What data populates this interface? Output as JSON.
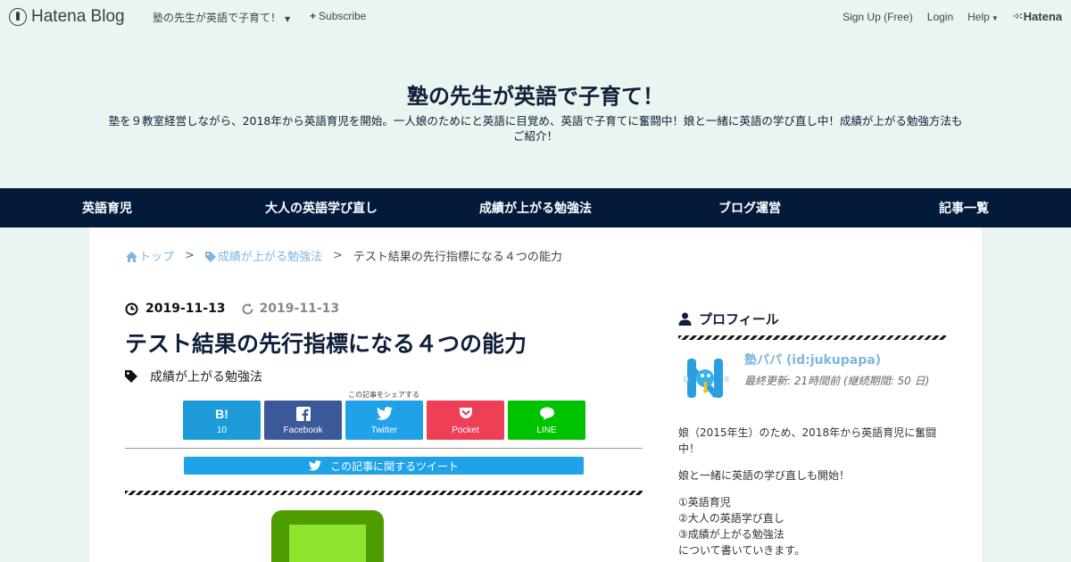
{
  "topbar": {
    "logo": "Hatena Blog",
    "blog_menu": "塾の先生が英語で子育て！",
    "subscribe": "Subscribe",
    "signup": "Sign Up (Free)",
    "login": "Login",
    "help": "Help",
    "hatena": "Hatena"
  },
  "header": {
    "title": "塾の先生が英語で子育て！",
    "description_line1": "塾を９教室経営しながら、2018年から英語育児を開始。一人娘のためにと英語に目覚め、英語で子育てに奮闘中！娘と一緒に英語の学び直し中！成績が上がる勉強方法も",
    "description_line2": "ご紹介！"
  },
  "nav": {
    "items": [
      "英語育児",
      "大人の英語学び直し",
      "成績が上がる勉強法",
      "ブログ運営",
      "記事一覧"
    ]
  },
  "breadcrumb": {
    "top": "トップ",
    "category": "成績が上がる勉強法",
    "current": "テスト結果の先行指標になる４つの能力",
    "separator": ">"
  },
  "entry": {
    "date": "2019-11-13",
    "updated": "2019-11-13",
    "title": "テスト結果の先行指標になる４つの能力",
    "category": "成績が上がる勉強法"
  },
  "share": {
    "caption": "この記事をシェアする",
    "hatena_icon": "B!",
    "hatena_count": "10",
    "facebook": "Facebook",
    "twitter": "Twitter",
    "pocket": "Pocket",
    "line": "LINE",
    "tweet_bar": "この記事に関するツイート"
  },
  "sidebar": {
    "profile_title": "プロフィール",
    "name": "塾パパ (id:jukupapa)",
    "updated": "最終更新: 21時間前 (継続期間: 50 日)",
    "para1_line1": "娘（2015年生）のため、2018年から英語育児に奮闘",
    "para1_line2": "中！",
    "para2": "娘と一緒に英語の学び直しも開始！",
    "list": [
      "①英語育児",
      "②大人の英語学び直し",
      "③成績が上がる勉強法",
      "について書いていきます。"
    ]
  },
  "colors": {
    "background": "#eaf4f0",
    "nav": "#031a3b",
    "title": "#0f1f3a",
    "link": "#7fb6de"
  }
}
